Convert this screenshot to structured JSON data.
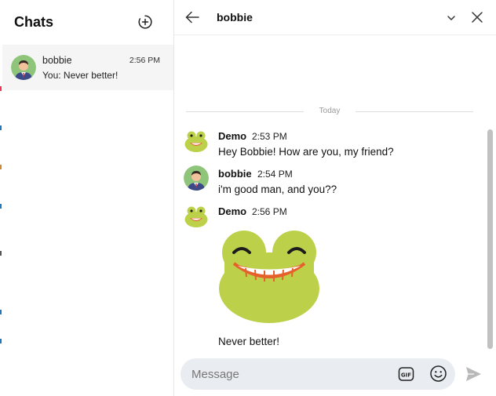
{
  "sidebar": {
    "title": "Chats",
    "conversations": [
      {
        "name": "bobbie",
        "time": "2:56 PM",
        "preview": "You: Never better!"
      }
    ]
  },
  "header": {
    "title": "bobbie"
  },
  "thread": {
    "date_divider": "Today",
    "messages": [
      {
        "sender": "Demo",
        "time": "2:53 PM",
        "text": "Hey Bobbie! How are you, my friend?"
      },
      {
        "sender": "bobbie",
        "time": "2:54 PM",
        "text": "i'm good man, and you??"
      },
      {
        "sender": "Demo",
        "time": "2:56 PM",
        "sticker": "frog-grin-sticker",
        "text": "Never better!"
      }
    ]
  },
  "composer": {
    "placeholder": "Message",
    "gif_label": "GIF"
  },
  "icons": {
    "new_chat": "add-circle-icon",
    "back": "arrow-left-icon",
    "collapse": "chevron-down-icon",
    "close": "close-icon",
    "emoji": "smiley-icon",
    "send": "send-icon"
  },
  "colors": {
    "frog_green": "#bcd149",
    "selected_bg": "#f5f5f5",
    "composer_bg": "#e9edf1",
    "send_disabled": "#b9b9b9"
  }
}
